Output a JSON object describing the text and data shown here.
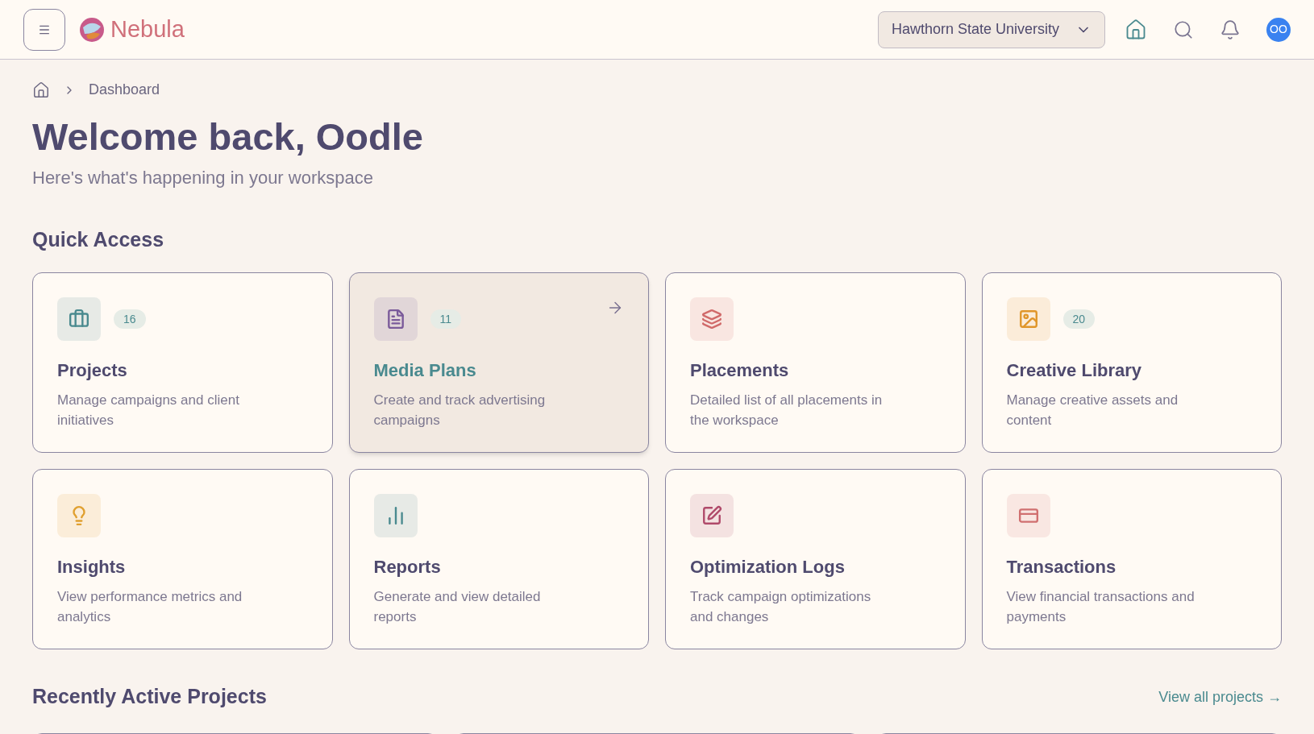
{
  "header": {
    "brand": "Nebula",
    "workspace": "Hawthorn State University",
    "avatar": "OO"
  },
  "breadcrumb": [
    "Dashboard"
  ],
  "title": "Welcome back, Oodle",
  "subtitle": "Here's what's happening in your workspace",
  "quick_access": {
    "title": "Quick Access",
    "cards": [
      {
        "kind": "briefcase",
        "color": "#4a8a8f",
        "title": "Projects",
        "count": "16",
        "description": "Manage campaigns and client initiatives",
        "hovered": false
      },
      {
        "kind": "file",
        "color": "#7a5a9a",
        "title": "Media Plans",
        "count": "11",
        "description": "Create and track advertising campaigns",
        "hovered": true
      },
      {
        "kind": "layers",
        "color": "#d06a6a",
        "title": "Placements",
        "description": "Detailed list of all placements in the workspace",
        "hovered": false
      },
      {
        "kind": "image",
        "color": "#e0962a",
        "title": "Creative Library",
        "count": "20",
        "description": "Manage creative assets and content",
        "hovered": false
      },
      {
        "kind": "bulb",
        "color": "#e0a030",
        "title": "Insights",
        "description": "View performance metrics and analytics",
        "hovered": false
      },
      {
        "kind": "chart",
        "color": "#4a8a8f",
        "title": "Reports",
        "description": "Generate and view detailed reports",
        "hovered": false
      },
      {
        "kind": "pen",
        "color": "#b04a6a",
        "title": "Optimization Logs",
        "description": "Track campaign optimizations and changes",
        "hovered": false
      },
      {
        "kind": "card",
        "color": "#d07070",
        "title": "Transactions",
        "description": "View financial transactions and payments",
        "hovered": false
      }
    ]
  },
  "recent_projects": {
    "title": "Recently Active Projects",
    "link": "View all projects →"
  }
}
